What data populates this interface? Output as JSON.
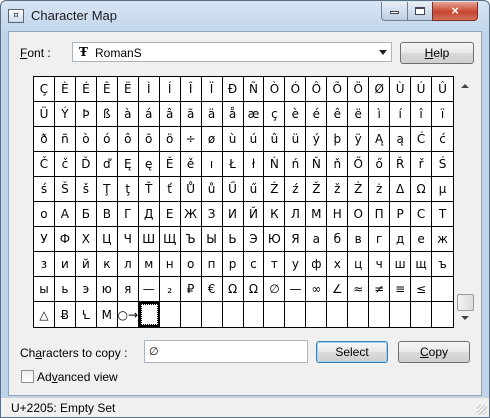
{
  "window": {
    "title": "Character Map",
    "icon_label": "¤",
    "controls": {
      "minimize": "",
      "maximize": "",
      "close": "×"
    }
  },
  "font": {
    "label_prefix": "",
    "label_access_key": "F",
    "label_rest": "ont :",
    "icon_glyph": "Ŧ",
    "selected": "RomanS"
  },
  "buttons": {
    "help_access": "H",
    "help_rest": "elp",
    "select": "Select",
    "copy_access": "C",
    "copy_rest": "opy"
  },
  "grid": {
    "selected_index": 185,
    "cells": [
      "Ç",
      "È",
      "É",
      "Ê",
      "Ë",
      "Ì",
      "Í",
      "Î",
      "Ï",
      "Đ",
      "Ñ",
      "Ò",
      "Ó",
      "Ô",
      "Õ",
      "Ö",
      "Ø",
      "Ù",
      "Ú",
      "Û",
      "Ü",
      "Ý",
      "Þ",
      "ß",
      "à",
      "á",
      "â",
      "ã",
      "ä",
      "å",
      "æ",
      "ç",
      "è",
      "é",
      "ê",
      "ë",
      "ì",
      "í",
      "î",
      "ï",
      "ð",
      "ñ",
      "ò",
      "ó",
      "ô",
      "õ",
      "ö",
      "÷",
      "ø",
      "ù",
      "ú",
      "û",
      "ü",
      "ý",
      "þ",
      "ÿ",
      "Ą",
      "ą",
      "Ć",
      "ć",
      "Č",
      "č",
      "Ď",
      "ď",
      "Ę",
      "ę",
      "Ě",
      "ě",
      "ı",
      "Ł",
      "ł",
      "Ń",
      "ń",
      "Ň",
      "ň",
      "Ő",
      "ő",
      "Ř",
      "ř",
      "Ś",
      "ś",
      "Š",
      "š",
      "Ţ",
      "ţ",
      "Ť",
      "ť",
      "Ů",
      "ů",
      "Ű",
      "ű",
      "Ź",
      "ź",
      "Ž",
      "ž",
      "Ż",
      "ż",
      "Δ",
      "Ω",
      "µ",
      "о",
      "А",
      "Б",
      "В",
      "Г",
      "Д",
      "Е",
      "Ж",
      "З",
      "И",
      "Й",
      "К",
      "Л",
      "М",
      "Н",
      "О",
      "П",
      "Р",
      "С",
      "Т",
      "У",
      "Ф",
      "Х",
      "Ц",
      "Ч",
      "Ш",
      "Щ",
      "Ъ",
      "Ы",
      "Ь",
      "Э",
      "Ю",
      "Я",
      "а",
      "б",
      "в",
      "г",
      "д",
      "е",
      "ж",
      "з",
      "и",
      "й",
      "к",
      "л",
      "м",
      "н",
      "о",
      "п",
      "р",
      "с",
      "т",
      "у",
      "ф",
      "х",
      "ц",
      "ч",
      "ш",
      "щ",
      "ъ",
      "ы",
      "ь",
      "э",
      "ю",
      "я",
      "—",
      "₂",
      "₽",
      "€",
      "Ω",
      "Ω",
      "∅",
      "—",
      "∞",
      "∠",
      "≈",
      "≠",
      "≡",
      "≤",
      "",
      "△",
      "Ƀ",
      "Ꝇ",
      "M",
      "○→",
      "",
      "",
      "",
      "",
      "",
      "",
      "",
      "",
      "",
      "",
      "",
      "",
      "",
      "",
      ""
    ]
  },
  "copy": {
    "label_prefix": "Ch",
    "label_access_key": "a",
    "label_rest": "racters to copy :",
    "value": "∅"
  },
  "advanced": {
    "label_prefix": "Ad",
    "label_access_key": "v",
    "label_rest": "anced view",
    "checked": false
  },
  "status": {
    "text": "U+2205: Empty Set"
  }
}
